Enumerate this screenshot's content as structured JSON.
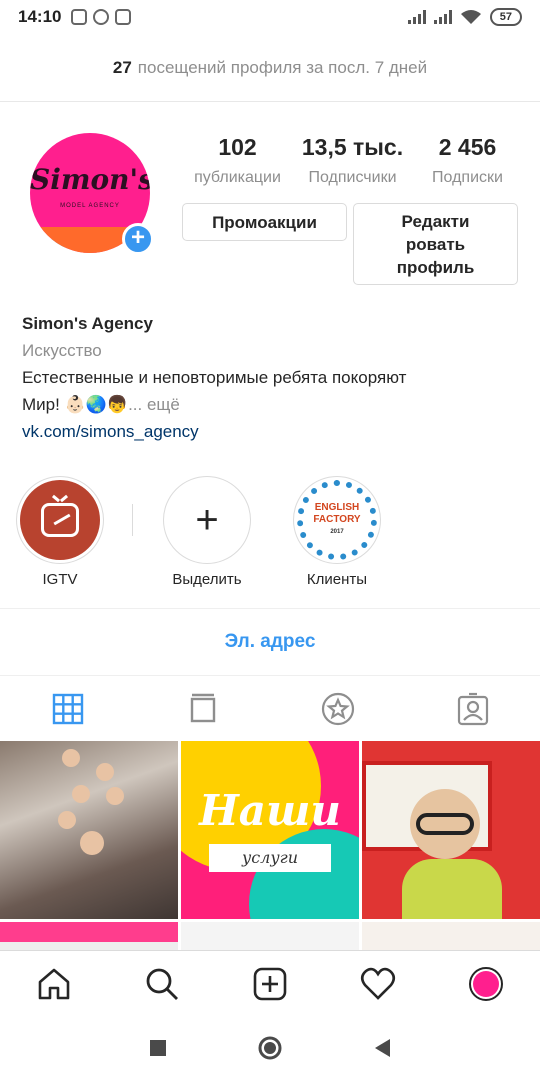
{
  "status_bar": {
    "time": "14:10",
    "battery": "57"
  },
  "banner": {
    "count": "27",
    "text": "посещений профиля за посл. 7 дней"
  },
  "profile": {
    "avatar_text": "Simon's",
    "avatar_subtext": "MODEL AGENCY",
    "stats": [
      {
        "value": "102",
        "label": "публикации"
      },
      {
        "value": "13,5 тыс.",
        "label": "Подписчики"
      },
      {
        "value": "2 456",
        "label": "Подписки"
      }
    ],
    "promo_button": "Промоакции",
    "edit_button": "Редакти ровать профиль"
  },
  "bio": {
    "name": "Simon's Agency",
    "category": "Искусство",
    "line1": "Естественные и неповторимые ребята покоряют",
    "line2": "Мир! 👶🏻🌏👦",
    "more": "... ещё",
    "link": "vk.com/simons_agency"
  },
  "highlights": [
    {
      "label": "IGTV",
      "icon": "igtv-icon"
    },
    {
      "label": "Выделить",
      "icon": "plus-icon"
    },
    {
      "label": "Клиенты",
      "icon": "english-factory-logo",
      "logo_text": "ENGLISH FACTORY",
      "logo_year": "2017"
    }
  ],
  "email_button": "Эл. адрес",
  "tabs": [
    {
      "icon": "grid-icon",
      "active": true
    },
    {
      "icon": "igtv-tab-icon",
      "active": false
    },
    {
      "icon": "star-icon",
      "active": false
    },
    {
      "icon": "tagged-icon",
      "active": false
    }
  ],
  "posts": [
    {
      "type": "photo",
      "subject": "kids-group"
    },
    {
      "type": "graphic",
      "title": "Наши",
      "subtitle": "услуги"
    },
    {
      "type": "photo",
      "subject": "boy-glasses"
    },
    {
      "type": "photo",
      "subject": "partial"
    },
    {
      "type": "photo",
      "subject": "partial"
    },
    {
      "type": "photo",
      "subject": "partial"
    }
  ],
  "bottom_nav": [
    "home-icon",
    "search-icon",
    "new-post-icon",
    "activity-icon",
    "profile-avatar"
  ],
  "colors": {
    "accent": "#3897f0",
    "link": "#003569",
    "brand_pink": "#ff1f8e"
  }
}
